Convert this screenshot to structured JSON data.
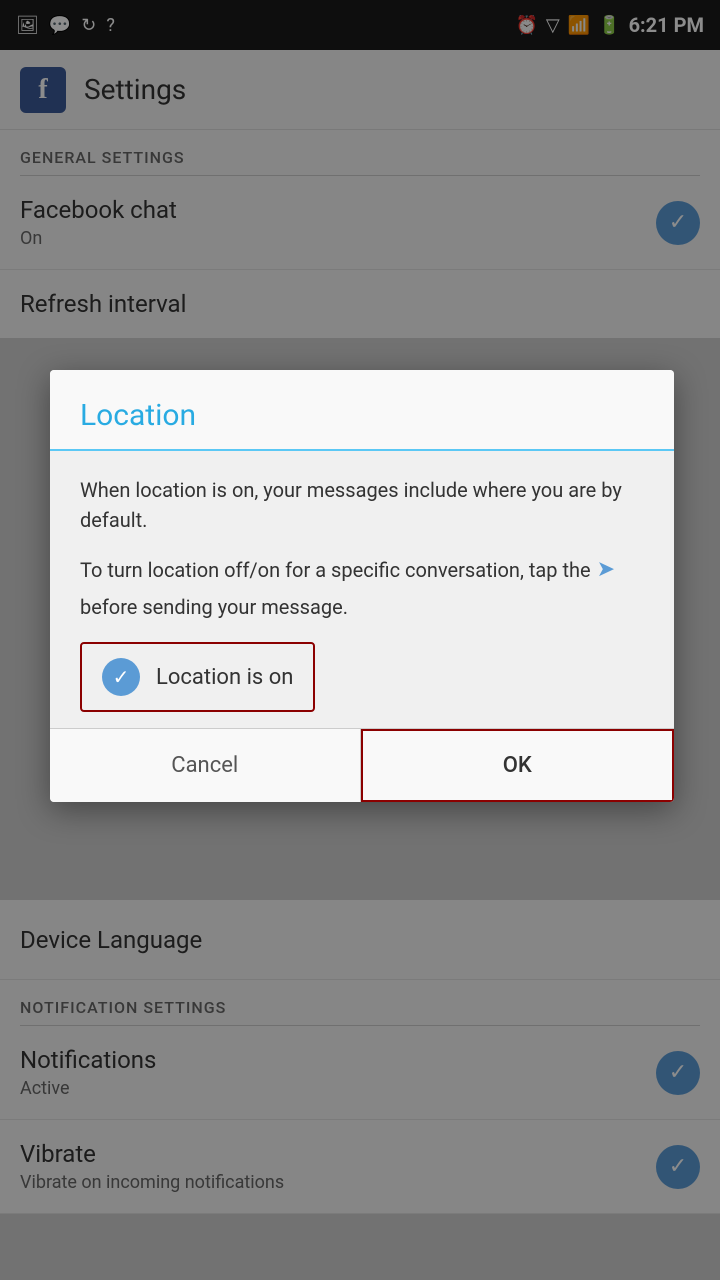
{
  "statusBar": {
    "time": "6:21 PM",
    "icons": [
      "image",
      "chat",
      "refresh",
      "help",
      "alarm",
      "wifi",
      "signal",
      "battery"
    ]
  },
  "header": {
    "appName": "Settings",
    "logo": "f"
  },
  "settings": {
    "generalSectionLabel": "GENERAL SETTINGS",
    "facebookChat": {
      "title": "Facebook chat",
      "subtitle": "On"
    },
    "refreshInterval": {
      "title": "Refresh interval"
    },
    "deviceLanguage": {
      "title": "Device Language"
    },
    "notificationSectionLabel": "NOTIFICATION SETTINGS",
    "notifications": {
      "title": "Notifications",
      "subtitle": "Active"
    },
    "vibrate": {
      "title": "Vibrate",
      "subtitle": "Vibrate on incoming notifications"
    }
  },
  "dialog": {
    "title": "Location",
    "bodyText1": "When location is on, your messages include where you are by default.",
    "bodyText2a": "To turn location off/on for a specific conversation, tap the",
    "bodyText2b": "before sending your message.",
    "locationArrow": "➤",
    "toggleLabel": "Location is on",
    "cancelLabel": "Cancel",
    "okLabel": "OK"
  }
}
